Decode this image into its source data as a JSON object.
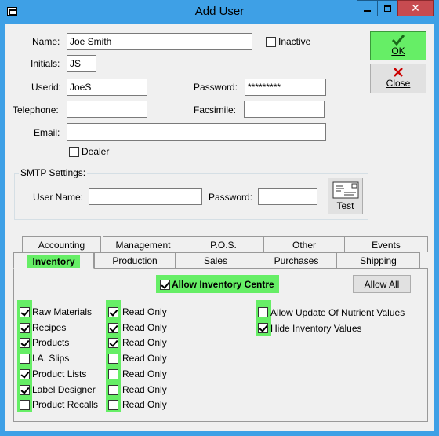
{
  "window": {
    "title": "Add User"
  },
  "form": {
    "name_label": "Name:",
    "name_value": "Joe Smith",
    "inactive_label": "Inactive",
    "initials_label": "Initials:",
    "initials_value": "JS",
    "userid_label": "Userid:",
    "userid_value": "JoeS",
    "password_label": "Password:",
    "password_value": "*********",
    "telephone_label": "Telephone:",
    "telephone_value": "",
    "facsimile_label": "Facsimile:",
    "facsimile_value": "",
    "email_label": "Email:",
    "email_value": "",
    "dealer_label": "Dealer"
  },
  "smtp": {
    "title": "SMTP Settings:",
    "username_label": "User Name:",
    "username_value": "",
    "password_label": "Password:",
    "password_value": "",
    "test_label": "Test"
  },
  "buttons": {
    "ok_label": "OK",
    "close_label": "Close"
  },
  "tabs_back": [
    "Accounting",
    "Management",
    "P.O.S.",
    "Other",
    "Events"
  ],
  "tabs_front": [
    "Inventory",
    "Production",
    "Sales",
    "Purchases",
    "Shipping"
  ],
  "inventory": {
    "allow_centre_label": "Allow Inventory Centre",
    "allow_all_label": "Allow All",
    "rows": [
      {
        "label": "Raw Materials",
        "checked": true,
        "read_only": true
      },
      {
        "label": "Recipes",
        "checked": true,
        "read_only": true
      },
      {
        "label": "Products",
        "checked": true,
        "read_only": true
      },
      {
        "label": "I.A. Slips",
        "checked": false,
        "read_only": false
      },
      {
        "label": "Product Lists",
        "checked": true,
        "read_only": false
      },
      {
        "label": "Label Designer",
        "checked": true,
        "read_only": false
      },
      {
        "label": "Product Recalls",
        "checked": false,
        "read_only": false
      }
    ],
    "read_only_label": "Read Only",
    "right_options": [
      {
        "label": "Allow Update Of Nutrient Values",
        "checked": false
      },
      {
        "label": "Hide Inventory Values",
        "checked": true
      }
    ]
  }
}
